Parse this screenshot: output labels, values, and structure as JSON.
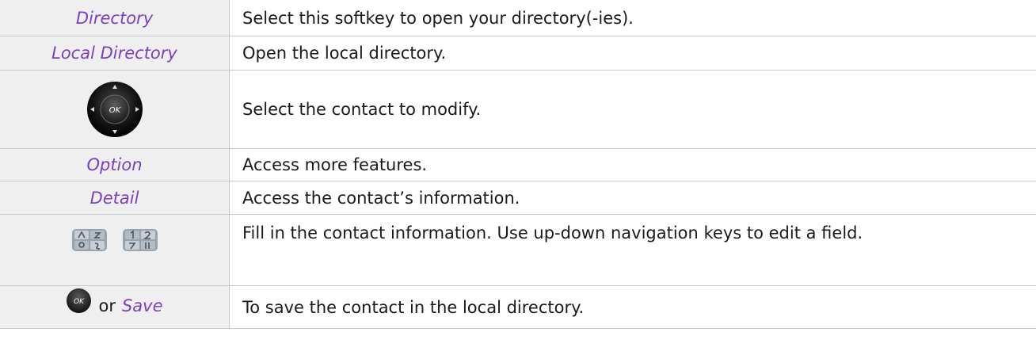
{
  "rows": [
    {
      "key": "Directory",
      "desc": "Select this softkey to open your directory(-ies)."
    },
    {
      "key": "Local Directory",
      "desc": "Open the local directory."
    },
    {
      "key_icon": "navigation-pad-icon",
      "nav_ok_label": "OK",
      "desc": "Select the contact to modify."
    },
    {
      "key": "Option",
      "desc": "Access more features."
    },
    {
      "key": "Detail",
      "desc": "Access the contact’s information."
    },
    {
      "key_icons": [
        "alpha-keypad-icon",
        "numeric-keypad-icon"
      ],
      "desc": "Fill in the contact information. Use up-down navigation keys to edit a field."
    },
    {
      "key_icon": "ok-button-icon",
      "ok_label": "OK",
      "or": "or",
      "key": "Save",
      "desc": "To save the contact in the local directory."
    }
  ],
  "colors": {
    "key_text": "#7b3fbf",
    "key_bg": "#efefef",
    "border": "#c9c9c9"
  }
}
